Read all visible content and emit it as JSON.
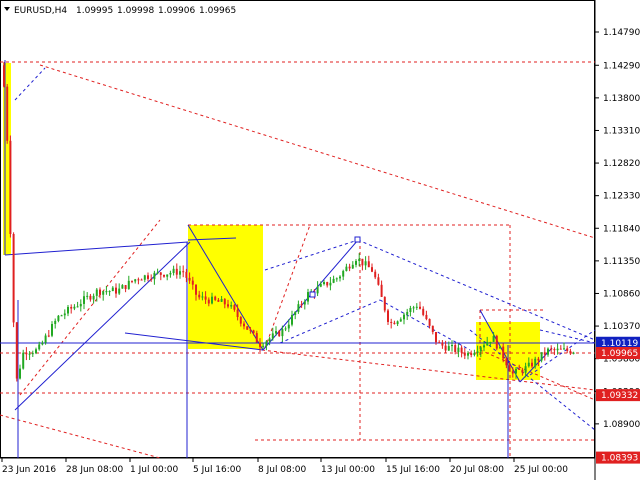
{
  "header": {
    "arrow_icon": "triangle-down-icon",
    "symbol": "EURUSD,H4",
    "open": "1.09995",
    "high": "1.09998",
    "low": "1.09906",
    "close": "1.09965"
  },
  "colors": {
    "up_candle": "#22a822",
    "down_candle": "#e02020",
    "red_line": "#e02020",
    "blue_line": "#2020d0",
    "yellow_box": "#ffff00",
    "blue_tag": "#1020c0",
    "axis": "#000000"
  },
  "chart_data": {
    "type": "candlestick",
    "price_levels": [
      "1.14790",
      "1.14290",
      "1.13800",
      "1.13310",
      "1.12820",
      "1.12330",
      "1.11840",
      "1.11350",
      "1.10860",
      "1.10370",
      "1.09880",
      "1.09390",
      "1.08900"
    ],
    "tagged_prices": [
      {
        "label": "1.10119",
        "color": "#1020c0",
        "text_color": "#ffffff",
        "value": 1.10119
      },
      {
        "label": "1.09965",
        "color": "#e02020",
        "text_color": "#ffffff",
        "value": 1.09965
      },
      {
        "label": "1.09332",
        "color": "#e02020",
        "text_color": "#ffffff",
        "value": 1.09332
      },
      {
        "label": "1.08393",
        "color": "#e02020",
        "text_color": "#ffffff",
        "value": 1.08393
      }
    ],
    "time_labels": [
      "23 Jun 2016",
      "28 Jun 08:00",
      "1 Jul 00:00",
      "5 Jul 16:00",
      "8 Jul 08:00",
      "13 Jul 00:00",
      "15 Jul 16:00",
      "20 Jul 08:00",
      "25 Jul 00:00"
    ],
    "ylim": [
      1.0839,
      1.1515
    ]
  }
}
